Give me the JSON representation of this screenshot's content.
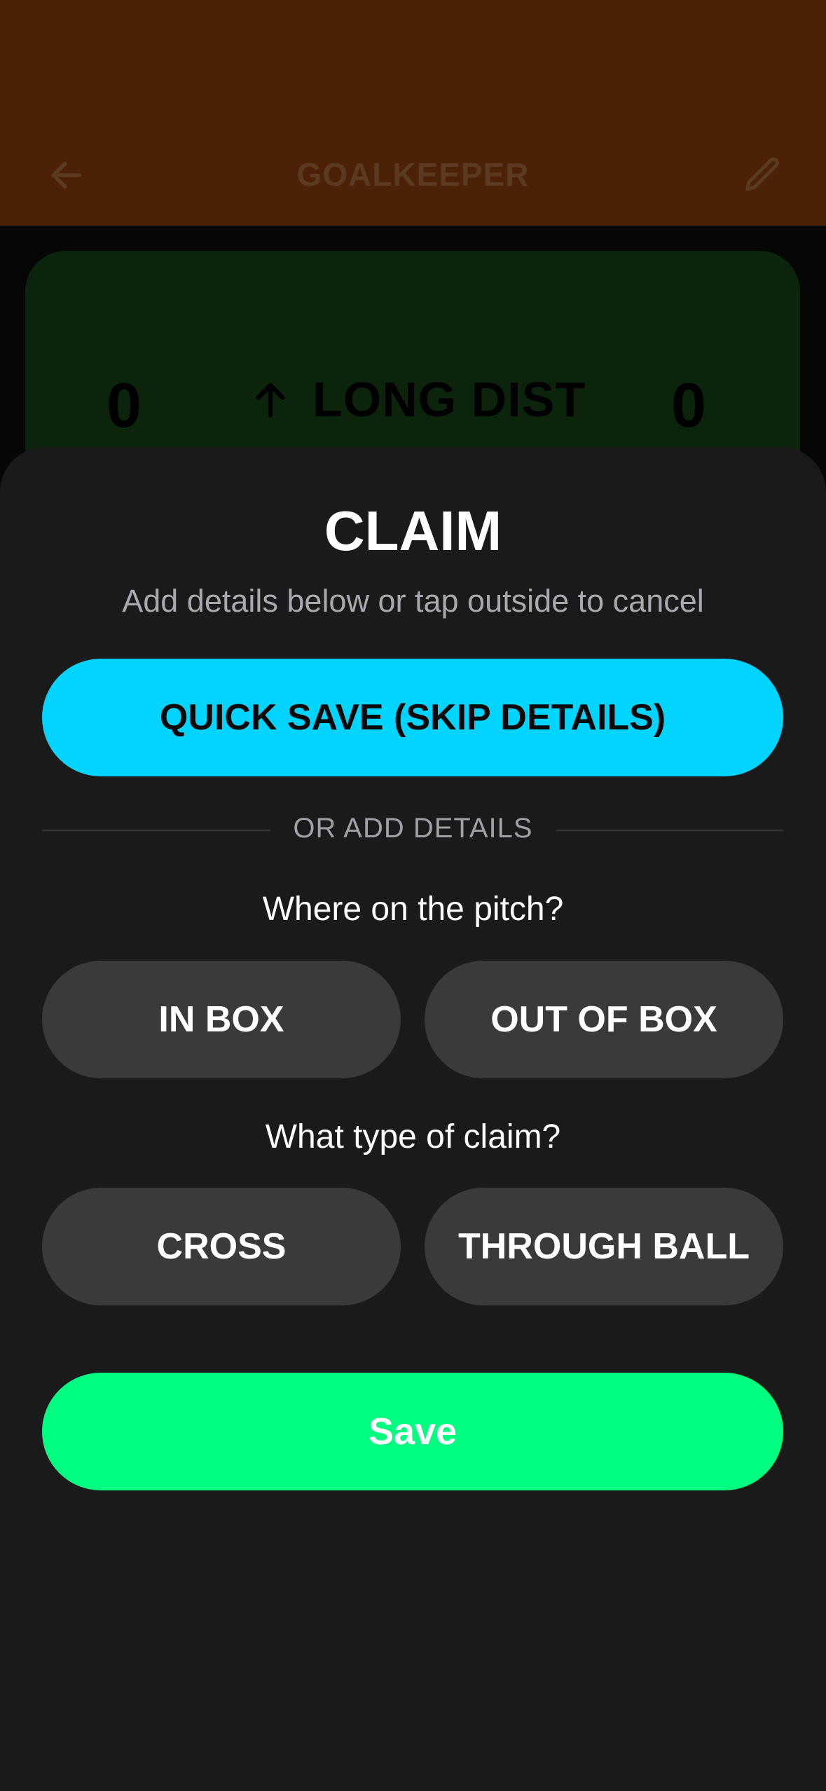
{
  "header": {
    "title": "GOALKEEPER",
    "back_icon": "arrow-left-icon",
    "edit_icon": "pencil-icon"
  },
  "stat_card": {
    "left_value": "0",
    "label": "LONG DIST",
    "right_value": "0",
    "arrow_icon": "arrow-up-icon"
  },
  "sheet": {
    "title": "CLAIM",
    "subtitle": "Add details below or tap outside to cancel",
    "quick_save_label": "QUICK SAVE (SKIP DETAILS)",
    "divider_label": "OR ADD DETAILS",
    "question_location": "Where on the pitch?",
    "location_options": [
      "IN BOX",
      "OUT OF BOX"
    ],
    "question_type": "What type of claim?",
    "type_options": [
      "CROSS",
      "THROUGH BALL"
    ],
    "save_label": "Save"
  },
  "colors": {
    "header_bg": "#4d2106",
    "card_bg": "#0c240c",
    "sheet_bg": "#1a1a1a",
    "quick_save_bg": "#00d4ff",
    "option_bg": "#3a3a3c",
    "save_bg": "#00ff80"
  }
}
